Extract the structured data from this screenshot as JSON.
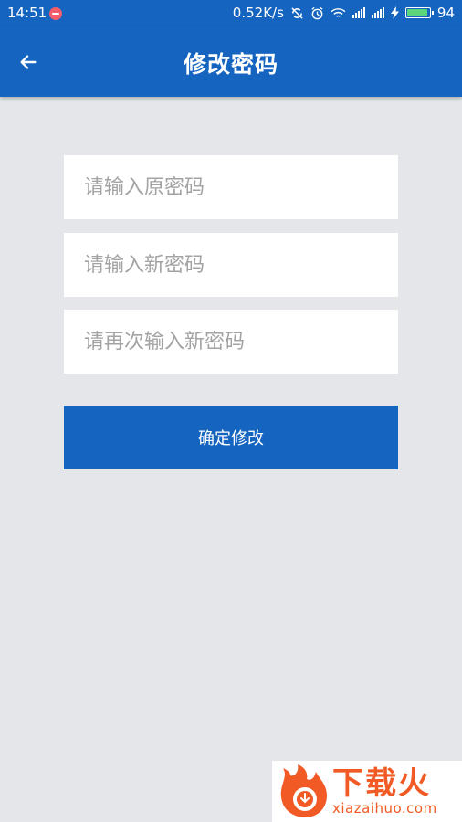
{
  "status_bar": {
    "time": "14:51",
    "network_speed": "0.52K/s",
    "battery_level": "94",
    "icons": [
      "notification-icon",
      "sync-off-icon",
      "alarm-icon",
      "wifi-icon",
      "signal-icon",
      "signal-icon",
      "charging-icon",
      "battery-icon"
    ]
  },
  "header": {
    "title": "修改密码",
    "back_icon": "arrow-left-icon"
  },
  "form": {
    "old_password_placeholder": "请输入原密码",
    "new_password_placeholder": "请输入新密码",
    "confirm_password_placeholder": "请再次输入新密码",
    "submit_label": "确定修改"
  },
  "watermark": {
    "brand_cn": "下载火",
    "brand_en": "xiazaihuo.com"
  },
  "colors": {
    "primary": "#1565c0",
    "background": "#e4e6e9",
    "watermark": "#f15a24"
  }
}
